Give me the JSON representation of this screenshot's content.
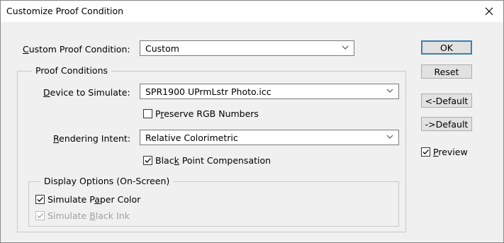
{
  "window": {
    "title": "Customize Proof Condition",
    "close_label": "Close"
  },
  "custom_proof_condition": {
    "label_prefix": "",
    "label_mnemonic": "C",
    "label_rest": "ustom Proof Condition:",
    "value": "Custom"
  },
  "proof_conditions": {
    "group_title": "Proof Conditions",
    "device": {
      "label_prefix": "",
      "label_mnemonic": "D",
      "label_rest": "evice to Simulate:",
      "value": "SPR1900 UPrmLstr Photo.icc"
    },
    "preserve_rgb": {
      "label_prefix": "P",
      "label_mnemonic": "r",
      "label_rest": "eserve RGB Numbers",
      "checked": false
    },
    "rendering_intent": {
      "label_prefix": "",
      "label_mnemonic": "R",
      "label_rest": "endering Intent:",
      "value": "Relative Colorimetric"
    },
    "black_point": {
      "label_prefix": "Blac",
      "label_mnemonic": "k",
      "label_rest": " Point Compensation",
      "checked": true
    }
  },
  "display_options": {
    "group_title": "Display Options (On-Screen)",
    "paper_color": {
      "label_prefix": "Simulate P",
      "label_mnemonic": "a",
      "label_rest": "per Color",
      "checked": true
    },
    "black_ink": {
      "label_prefix": "Simulate ",
      "label_mnemonic": "B",
      "label_rest": "lack Ink",
      "checked": true,
      "disabled": true
    }
  },
  "buttons": {
    "ok": "OK",
    "reset": "Reset",
    "load_default": "<-Default",
    "save_default": "->Default"
  },
  "preview": {
    "label_prefix": "",
    "label_mnemonic": "P",
    "label_rest": "review",
    "checked": true
  },
  "colors": {
    "default_button_border": "#3c7fb1",
    "disabled_text": "#a0a0a0"
  }
}
